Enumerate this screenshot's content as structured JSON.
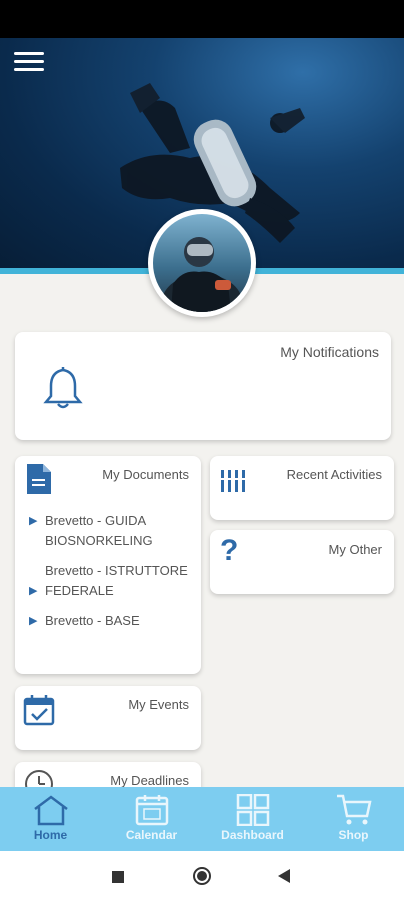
{
  "header": {
    "menu_icon": "hamburger-icon"
  },
  "colors": {
    "accent": "#2e6aa8",
    "tab_bar": "#7dcdf0",
    "stripe": "#41b3d8"
  },
  "cards": {
    "notifications": {
      "title": "My Notifications",
      "icon": "bell-icon"
    },
    "documents": {
      "title": "My Documents",
      "icon": "document-icon",
      "items": [
        "Brevetto - GUIDA BIOSNORKELING",
        "Brevetto - ISTRUTTORE FEDERALE",
        "Brevetto - BASE"
      ]
    },
    "activities": {
      "title": "Recent Activities",
      "icon": "bars-icon"
    },
    "other": {
      "title": "My Other",
      "icon": "question-icon",
      "glyph": "?"
    },
    "events": {
      "title": "My Events",
      "icon": "calendar-check-icon"
    },
    "deadlines": {
      "title": "My Deadlines",
      "icon": "clock-icon"
    }
  },
  "tabs": [
    {
      "label": "Home",
      "icon": "home-icon",
      "active": true
    },
    {
      "label": "Calendar",
      "icon": "calendar-icon",
      "active": false
    },
    {
      "label": "Dashboard",
      "icon": "dashboard-icon",
      "active": false
    },
    {
      "label": "Shop",
      "icon": "cart-icon",
      "active": false
    }
  ],
  "system_nav": [
    "recents-icon",
    "home-circle-icon",
    "back-icon"
  ]
}
